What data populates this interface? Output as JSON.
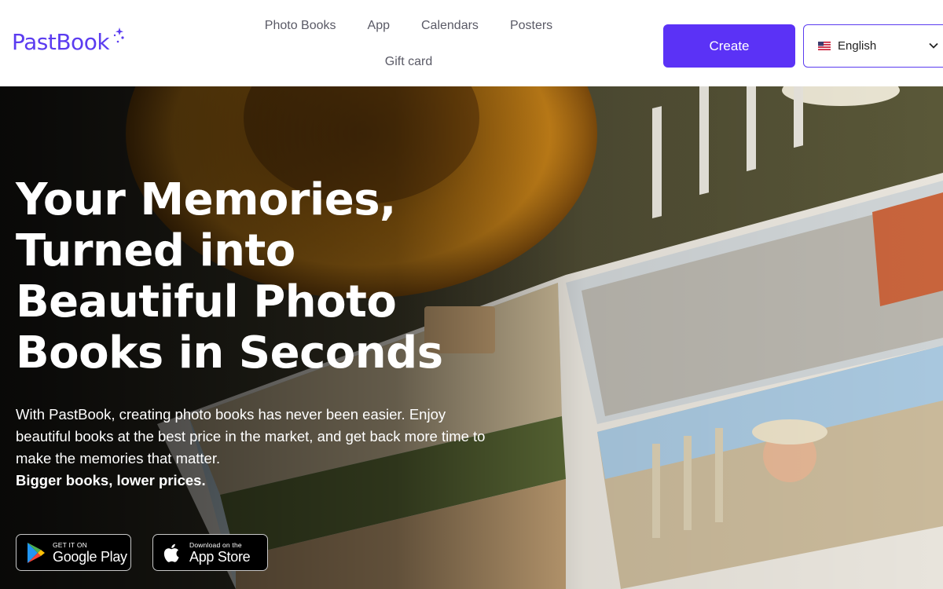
{
  "header": {
    "logo_text": "PastBook",
    "brand_color": "#5b3cf0",
    "nav": [
      {
        "label": "Photo Books"
      },
      {
        "label": "App"
      },
      {
        "label": "Calendars"
      },
      {
        "label": "Posters"
      },
      {
        "label": "Gift card"
      }
    ],
    "create_label": "Create",
    "language": {
      "selected": "English",
      "flag_icon": "us-flag-icon"
    }
  },
  "hero": {
    "title": "Your Memories, Turned into Beautiful Photo Books in Seconds",
    "description": "With PastBook, creating photo books has never been easier. Enjoy beautiful books at the best price in the market, and get back more time to make the memories that matter.",
    "tagline": "Bigger books, lower prices."
  },
  "badges": {
    "google": {
      "small": "GET IT ON",
      "big": "Google Play",
      "icon": "google-play-icon"
    },
    "apple": {
      "small": "Download on the",
      "big": "App Store",
      "icon": "apple-icon"
    }
  }
}
